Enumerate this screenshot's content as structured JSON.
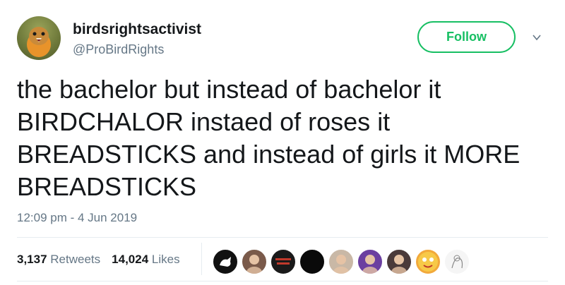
{
  "author": {
    "display_name": "birdsrightsactivist",
    "handle": "@ProBirdRights",
    "avatar_icon": "robin-bird-avatar"
  },
  "follow_label": "Follow",
  "tweet_text": "the bachelor but instead of bachelor it\nBIRDCHALOR instaed of roses it\nBREADSTICKS and instead of girls it MORE\nBREADSTICKS",
  "timestamp": "12:09 pm - 4 Jun 2019",
  "stats": {
    "retweets_count": "3,137",
    "retweets_label": "Retweets",
    "likes_count": "14,024",
    "likes_label": "Likes"
  },
  "likers": [
    {
      "icon": "liker-avatar-dark-animal",
      "color": "#111111"
    },
    {
      "icon": "liker-avatar-person-1",
      "color": "#7a5a4a"
    },
    {
      "icon": "liker-avatar-text-logo",
      "color": "#1a1a1a"
    },
    {
      "icon": "liker-avatar-black",
      "color": "#0a0a0a"
    },
    {
      "icon": "liker-avatar-person-2",
      "color": "#c9b8a6"
    },
    {
      "icon": "liker-avatar-person-3",
      "color": "#6b3fa0"
    },
    {
      "icon": "liker-avatar-person-4",
      "color": "#4a3a3a"
    },
    {
      "icon": "liker-avatar-emoji",
      "color": "#f2a93b"
    },
    {
      "icon": "liker-avatar-sketch",
      "color": "#f5f5f5"
    }
  ]
}
